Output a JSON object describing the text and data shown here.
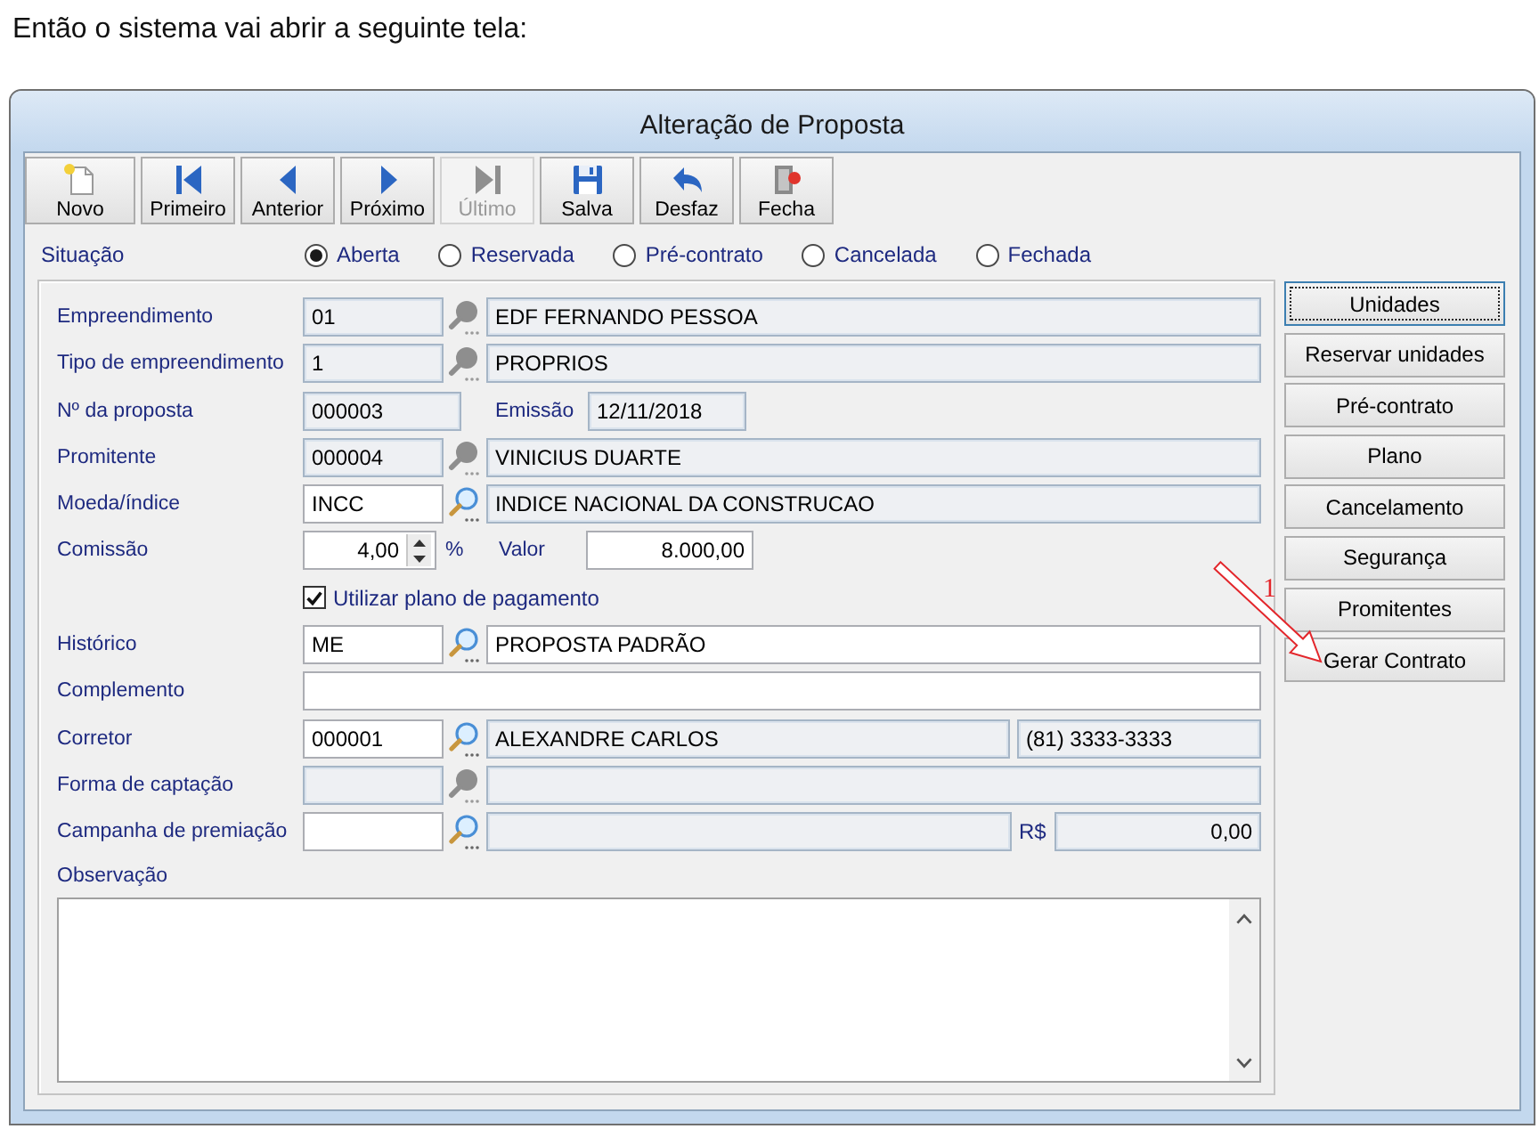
{
  "caption": "Então o sistema vai abrir a seguinte tela:",
  "window": {
    "title": "Alteração de Proposta"
  },
  "toolbar": [
    {
      "kind": "new",
      "label": "Novo",
      "disabled": false
    },
    {
      "kind": "first",
      "label": "Primeiro",
      "disabled": false
    },
    {
      "kind": "previous",
      "label": "Anterior",
      "disabled": false
    },
    {
      "kind": "next",
      "label": "Próximo",
      "disabled": false
    },
    {
      "kind": "last",
      "label": "Último",
      "disabled": true
    },
    {
      "kind": "save",
      "label": "Salva",
      "disabled": false
    },
    {
      "kind": "undo",
      "label": "Desfaz",
      "disabled": false
    },
    {
      "kind": "close",
      "label": "Fecha",
      "disabled": false
    }
  ],
  "situacao": {
    "label": "Situação",
    "options": [
      {
        "label": "Aberta",
        "selected": true
      },
      {
        "label": "Reservada",
        "selected": false
      },
      {
        "label": "Pré-contrato",
        "selected": false
      },
      {
        "label": "Cancelada",
        "selected": false
      },
      {
        "label": "Fechada",
        "selected": false
      }
    ]
  },
  "form": {
    "rows": [
      {
        "kind": "lookup",
        "label": "Empreendimento",
        "code": {
          "value": "01",
          "readonly": true
        },
        "lookup_enabled": false,
        "description": {
          "value": "EDF FERNANDO PESSOA",
          "readonly": true
        }
      },
      {
        "kind": "lookup",
        "label": "Tipo de empreendimento",
        "code": {
          "value": "1",
          "readonly": true
        },
        "lookup_enabled": false,
        "description": {
          "value": "PROPRIOS",
          "readonly": true
        }
      },
      {
        "kind": "pair",
        "label": "Nº da proposta",
        "code": {
          "value": "000003",
          "readonly": true
        },
        "second_label": "Emissão",
        "second": {
          "value": "12/11/2018",
          "readonly": true
        }
      },
      {
        "kind": "lookup",
        "label": "Promitente",
        "code": {
          "value": "000004",
          "readonly": true
        },
        "lookup_enabled": false,
        "description": {
          "value": "VINICIUS DUARTE",
          "readonly": true
        }
      },
      {
        "kind": "lookup",
        "label": "Moeda/índice",
        "code": {
          "value": "INCC",
          "readonly": false
        },
        "lookup_enabled": true,
        "description": {
          "value": "INDICE NACIONAL DA CONSTRUCAO",
          "readonly": true
        }
      },
      {
        "kind": "spin",
        "label": "Comissão",
        "code": {
          "value": "4,00",
          "readonly": false
        },
        "unit": "%",
        "second_label": "Valor",
        "second": {
          "value": "8.000,00",
          "readonly": false
        }
      },
      {
        "kind": "checkbox",
        "label": "Utilizar plano de pagamento",
        "checked": true
      },
      {
        "kind": "lookup",
        "label": "Histórico",
        "code": {
          "value": "ME",
          "readonly": false
        },
        "lookup_enabled": true,
        "description": {
          "value": "PROPOSTA PADRÃO",
          "readonly": false
        }
      },
      {
        "kind": "text",
        "label": "Complemento",
        "field": {
          "readonly": false
        }
      },
      {
        "kind": "lookup",
        "label": "Corretor",
        "code": {
          "value": "000001",
          "readonly": false
        },
        "lookup_enabled": true,
        "description": {
          "value": "ALEXANDRE CARLOS",
          "readonly": true
        },
        "extra": {
          "value": "(81) 3333-3333",
          "readonly": true
        }
      },
      {
        "kind": "lookup",
        "label": "Forma de captação",
        "code": {
          "readonly": true
        },
        "lookup_enabled": false,
        "description": {
          "readonly": true
        }
      },
      {
        "kind": "lookup",
        "label": "Campanha de premiação",
        "code": {
          "readonly": false
        },
        "lookup_enabled": true,
        "description": {
          "readonly": true
        },
        "extra_label": "R$",
        "extra": {
          "value": "0,00",
          "readonly": true
        }
      }
    ],
    "notes": {
      "label": "Observação"
    }
  },
  "side_buttons": [
    {
      "label": "Unidades",
      "focused": true
    },
    {
      "label": "Reservar unidades",
      "focused": false
    },
    {
      "label": "Pré-contrato",
      "focused": false
    },
    {
      "label": "Plano",
      "focused": false
    },
    {
      "label": "Cancelamento",
      "focused": false
    },
    {
      "label": "Segurança",
      "focused": false
    },
    {
      "label": "Promitentes",
      "focused": false
    },
    {
      "label": "Gerar Contrato",
      "focused": false
    }
  ],
  "annotation": {
    "label": "1"
  }
}
